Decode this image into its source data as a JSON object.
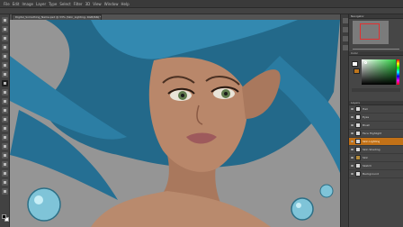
{
  "document": {
    "tab_title": "Digital_Something_Name.psd @ 33% (Skin_Lighting, RGB/8#) *",
    "tab_close": "×"
  },
  "menubar": {
    "items": [
      "File",
      "Edit",
      "Image",
      "Layer",
      "Type",
      "Select",
      "Filter",
      "3D",
      "View",
      "Window",
      "Help"
    ]
  },
  "tools": [
    {
      "icon": "move-tool-icon"
    },
    {
      "icon": "marquee-tool-icon"
    },
    {
      "icon": "lasso-tool-icon"
    },
    {
      "icon": "quick-select-tool-icon"
    },
    {
      "icon": "crop-tool-icon"
    },
    {
      "icon": "eyedropper-tool-icon"
    },
    {
      "icon": "healing-brush-tool-icon"
    },
    {
      "icon": "brush-tool-icon",
      "active": true
    },
    {
      "icon": "clone-stamp-tool-icon"
    },
    {
      "icon": "history-brush-tool-icon"
    },
    {
      "icon": "eraser-tool-icon"
    },
    {
      "icon": "gradient-tool-icon"
    },
    {
      "icon": "blur-tool-icon"
    },
    {
      "icon": "dodge-tool-icon"
    },
    {
      "icon": "pen-tool-icon"
    },
    {
      "icon": "type-tool-icon"
    },
    {
      "icon": "path-select-tool-icon"
    },
    {
      "icon": "shape-tool-icon"
    },
    {
      "icon": "hand-tool-icon"
    },
    {
      "icon": "zoom-tool-icon"
    }
  ],
  "colors": {
    "foreground": "#000000",
    "background": "#ffffff",
    "panel_fg_chip": "#ffffff",
    "panel_bg_chip": "#c0761c",
    "selected_layer": "#c27117",
    "hair": "#2f7fa3",
    "skin": "#b9876a",
    "canvas_bg": "#959595"
  },
  "panels": {
    "navigator_title": "Navigator",
    "color_title": "Color",
    "layers_title": "Layers"
  },
  "layers": [
    {
      "name": "Hair",
      "selected": false,
      "group": false
    },
    {
      "name": "Eyes",
      "selected": false,
      "group": false
    },
    {
      "name": "Blush",
      "selected": false,
      "group": false
    },
    {
      "name": "Face Highlight",
      "selected": false,
      "group": false
    },
    {
      "name": "Skin Lighting",
      "selected": true,
      "group": false
    },
    {
      "name": "Skin Shading",
      "selected": false,
      "group": false
    },
    {
      "name": "Skin",
      "selected": false,
      "group": true
    },
    {
      "name": "Sketch",
      "selected": false,
      "group": false
    },
    {
      "name": "Background",
      "selected": false,
      "group": false
    }
  ]
}
